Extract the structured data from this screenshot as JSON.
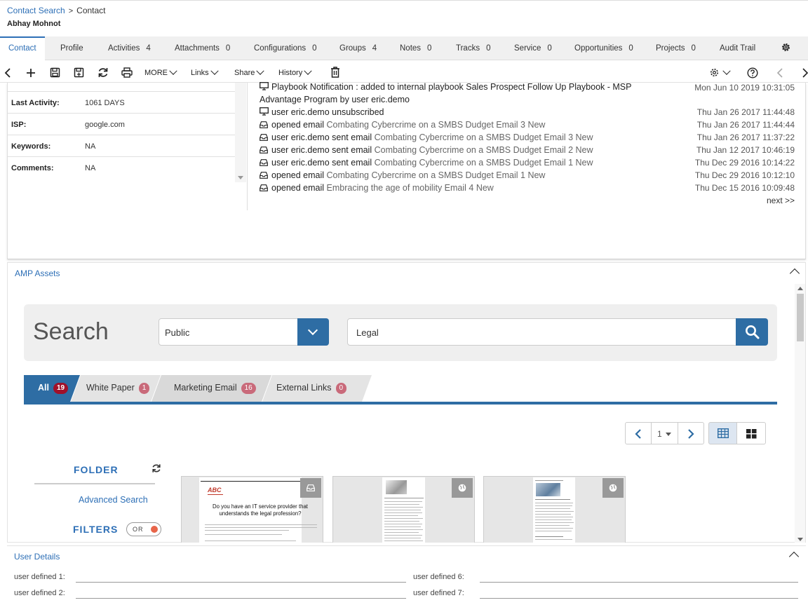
{
  "breadcrumb": {
    "link": "Contact Search",
    "current": "Contact"
  },
  "contact_name": "Abhay Mohnot",
  "tabs": [
    {
      "label": "Contact",
      "count": ""
    },
    {
      "label": "Profile",
      "count": ""
    },
    {
      "label": "Activities",
      "count": "4"
    },
    {
      "label": "Attachments",
      "count": "0"
    },
    {
      "label": "Configurations",
      "count": "0"
    },
    {
      "label": "Groups",
      "count": "4"
    },
    {
      "label": "Notes",
      "count": "0"
    },
    {
      "label": "Tracks",
      "count": "0"
    },
    {
      "label": "Service",
      "count": "0"
    },
    {
      "label": "Opportunities",
      "count": "0"
    },
    {
      "label": "Projects",
      "count": "0"
    },
    {
      "label": "Audit Trail",
      "count": ""
    }
  ],
  "toolbar": {
    "more": "MORE",
    "links": "Links",
    "share": "Share",
    "history": "History"
  },
  "properties": [
    {
      "key": "Last Activity:",
      "value": "1061 DAYS"
    },
    {
      "key": "ISP:",
      "value": "google.com"
    },
    {
      "key": "Keywords:",
      "value": "NA"
    },
    {
      "key": "Comments:",
      "value": "NA"
    }
  ],
  "activity_feed": [
    {
      "icon": "monitor",
      "prefix": "Playbook Notification : added to internal playbook ",
      "link": "Sales Prospect Follow Up Playbook - MSP",
      "date": "Mon Jun 10 2019 10:31:05"
    },
    {
      "icon": "",
      "prefix": "Advantage Program by user eric.demo",
      "link": "",
      "date": ""
    },
    {
      "icon": "monitor",
      "prefix": "user eric.demo unsubscribed",
      "link": "",
      "date": "Thu Jan 26 2017 11:44:48"
    },
    {
      "icon": "tray",
      "prefix": "opened email ",
      "link": "Combating Cybercrime on a SMBS Dudget Email 3 New",
      "date": "Thu Jan 26 2017 11:44:44"
    },
    {
      "icon": "tray",
      "prefix": "user eric.demo sent email ",
      "link": "Combating Cybercrime on a SMBS Dudget Email 3 New",
      "date": "Thu Jan 26 2017 11:37:22"
    },
    {
      "icon": "tray",
      "prefix": "user eric.demo sent email ",
      "link": "Combating Cybercrime on a SMBS Dudget Email 2 New",
      "date": "Thu Jan 12 2017 10:46:19"
    },
    {
      "icon": "tray",
      "prefix": "user eric.demo sent email ",
      "link": "Combating Cybercrime on a SMBS Dudget Email 1 New",
      "date": "Thu Dec 29 2016 10:14:22"
    },
    {
      "icon": "tray",
      "prefix": "opened email ",
      "link": "Combating Cybercrime on a SMBS Dudget Email 1 New",
      "date": "Thu Dec 29 2016 10:12:10"
    },
    {
      "icon": "tray",
      "prefix": "opened email ",
      "link": "Embracing the age of mobility Email 4 New",
      "date": "Thu Dec 15 2016 10:09:48"
    }
  ],
  "feed_next": "next >>",
  "amp": {
    "title": "AMP Assets",
    "search_label": "Search",
    "scope": "Public",
    "query": "Legal",
    "filter_tabs": [
      {
        "label": "All",
        "count": "19"
      },
      {
        "label": "White Paper",
        "count": "1"
      },
      {
        "label": "Marketing Email",
        "count": "16"
      },
      {
        "label": "External Links",
        "count": "0"
      }
    ],
    "page": "1",
    "folder": "FOLDER",
    "advanced_search": "Advanced Search",
    "filters": "FILTERS",
    "toggle": "OR",
    "card1": {
      "logo": "ABC",
      "headline": "Do you have an IT service provider that understands the legal profession?"
    }
  },
  "user_details": {
    "title": "User Details",
    "fields": [
      "user defined 1:",
      "user defined 2:",
      "user defined 6:",
      "user defined 7:"
    ]
  },
  "colors": {
    "accent": "#2e6da4",
    "link": "#2d6fb6",
    "badge": "#c96a7a",
    "toggle_dot": "#e8654a"
  }
}
